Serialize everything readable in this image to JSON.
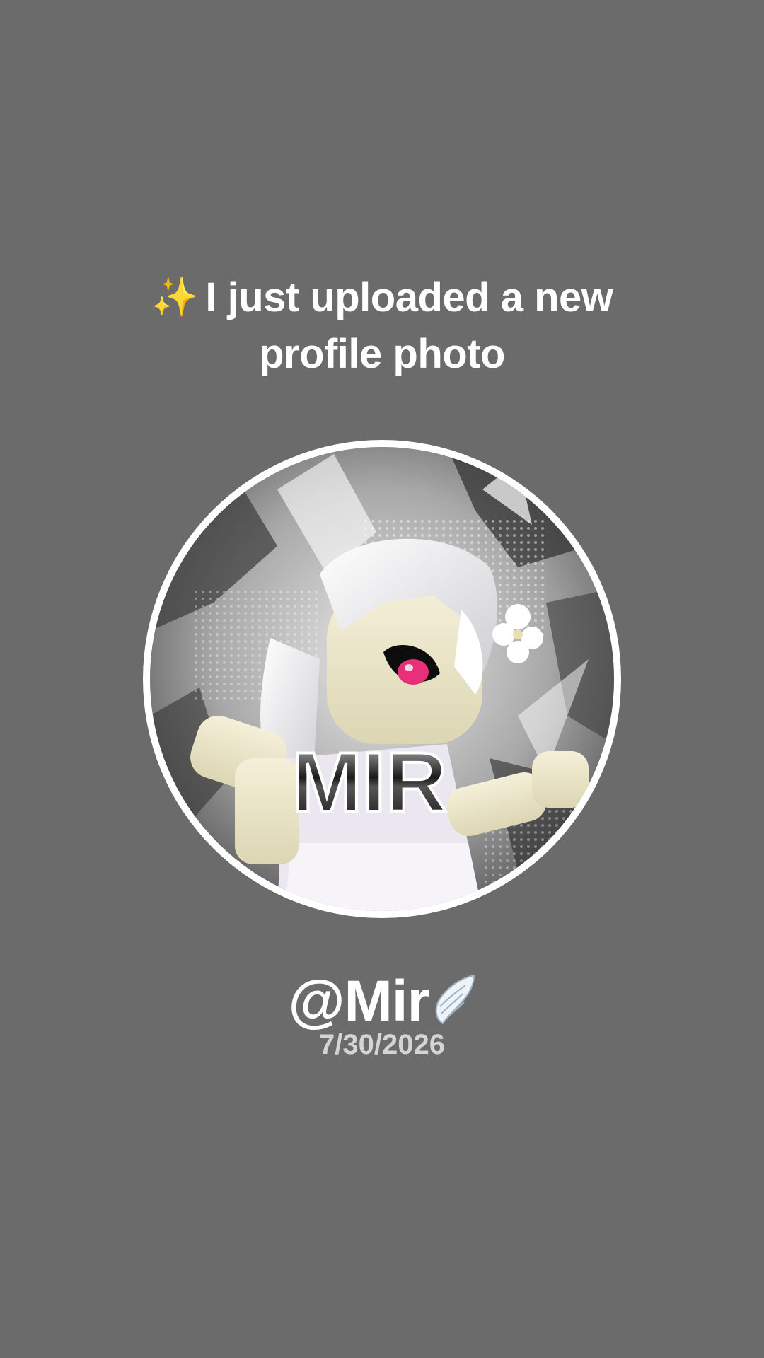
{
  "post": {
    "sparkle_icon": "sparkles-icon",
    "headline_line1": "I just uploaded a new",
    "headline_line2": "profile photo",
    "avatar_text": "MIR",
    "username": "@Mir",
    "username_icon": "angel-wing-icon",
    "date": "7/30/2026"
  },
  "colors": {
    "background": "#6b6b6b",
    "text": "#ffffff",
    "date_text": "#d4d4d4",
    "sparkle": "#f4c430",
    "avatar_ring": "#ffffff",
    "eye_accent": "#e8307a"
  }
}
